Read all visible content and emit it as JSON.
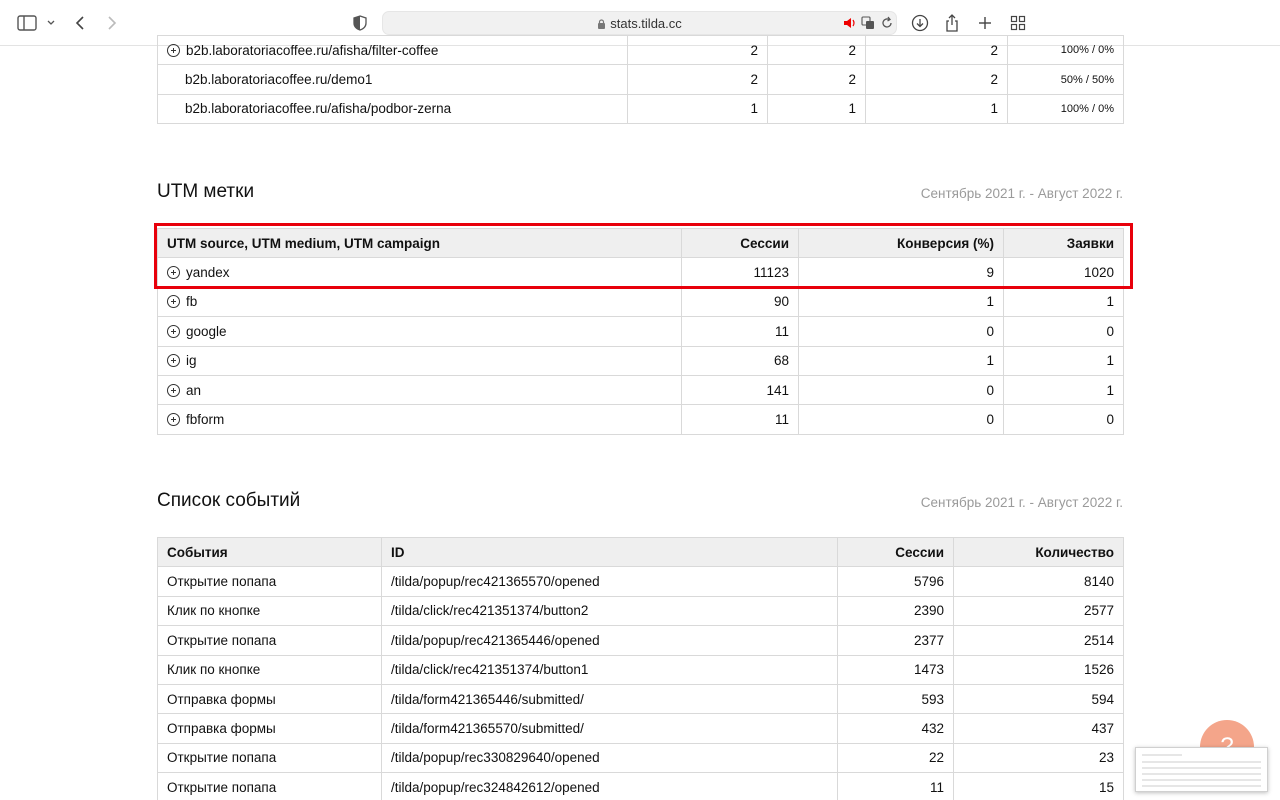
{
  "browser": {
    "url": "stats.tilda.cc"
  },
  "pages_table": {
    "rows": [
      {
        "page": "b2b.laboratoriacoffee.ru/afisha/filter-coffee",
        "c1": "2",
        "c2": "2",
        "c3": "2",
        "ratio": "100% / 0%",
        "expandable": true
      },
      {
        "page": "b2b.laboratoriacoffee.ru/demo1",
        "c1": "2",
        "c2": "2",
        "c3": "2",
        "ratio": "50% / 50%",
        "expandable": false
      },
      {
        "page": "b2b.laboratoriacoffee.ru/afisha/podbor-zerna",
        "c1": "1",
        "c2": "1",
        "c3": "1",
        "ratio": "100% / 0%",
        "expandable": false
      }
    ]
  },
  "utm": {
    "title": "UTM метки",
    "date_range": "Сентябрь 2021 г. - Август 2022 г.",
    "headers": [
      "UTM source, UTM medium, UTM campaign",
      "Сессии",
      "Конверсия (%)",
      "Заявки"
    ],
    "rows": [
      {
        "source": "yandex",
        "sessions": "11123",
        "conversion": "9",
        "requests": "1020"
      },
      {
        "source": "fb",
        "sessions": "90",
        "conversion": "1",
        "requests": "1"
      },
      {
        "source": "google",
        "sessions": "11",
        "conversion": "0",
        "requests": "0"
      },
      {
        "source": "ig",
        "sessions": "68",
        "conversion": "1",
        "requests": "1"
      },
      {
        "source": "an",
        "sessions": "141",
        "conversion": "0",
        "requests": "1"
      },
      {
        "source": "fbform",
        "sessions": "11",
        "conversion": "0",
        "requests": "0"
      }
    ]
  },
  "events": {
    "title": "Список событий",
    "date_range": "Сентябрь 2021 г. - Август 2022 г.",
    "headers": [
      "События",
      "ID",
      "Сессии",
      "Количество"
    ],
    "rows": [
      {
        "event": "Открытие попапа",
        "id": "/tilda/popup/rec421365570/opened",
        "sessions": "5796",
        "count": "8140"
      },
      {
        "event": "Клик по кнопке",
        "id": "/tilda/click/rec421351374/button2",
        "sessions": "2390",
        "count": "2577"
      },
      {
        "event": "Открытие попапа",
        "id": "/tilda/popup/rec421365446/opened",
        "sessions": "2377",
        "count": "2514"
      },
      {
        "event": "Клик по кнопке",
        "id": "/tilda/click/rec421351374/button1",
        "sessions": "1473",
        "count": "1526"
      },
      {
        "event": "Отправка формы",
        "id": "/tilda/form421365446/submitted/",
        "sessions": "593",
        "count": "594"
      },
      {
        "event": "Отправка формы",
        "id": "/tilda/form421365570/submitted/",
        "sessions": "432",
        "count": "437"
      },
      {
        "event": "Открытие попапа",
        "id": "/tilda/popup/rec330829640/opened",
        "sessions": "22",
        "count": "23"
      },
      {
        "event": "Открытие попапа",
        "id": "/tilda/popup/rec324842612/opened",
        "sessions": "11",
        "count": "15"
      }
    ]
  },
  "help": {
    "glyph": "?"
  },
  "colors": {
    "highlight": "#e8000b",
    "header_bg": "#efefef",
    "help_bubble": "#f4a58a"
  }
}
